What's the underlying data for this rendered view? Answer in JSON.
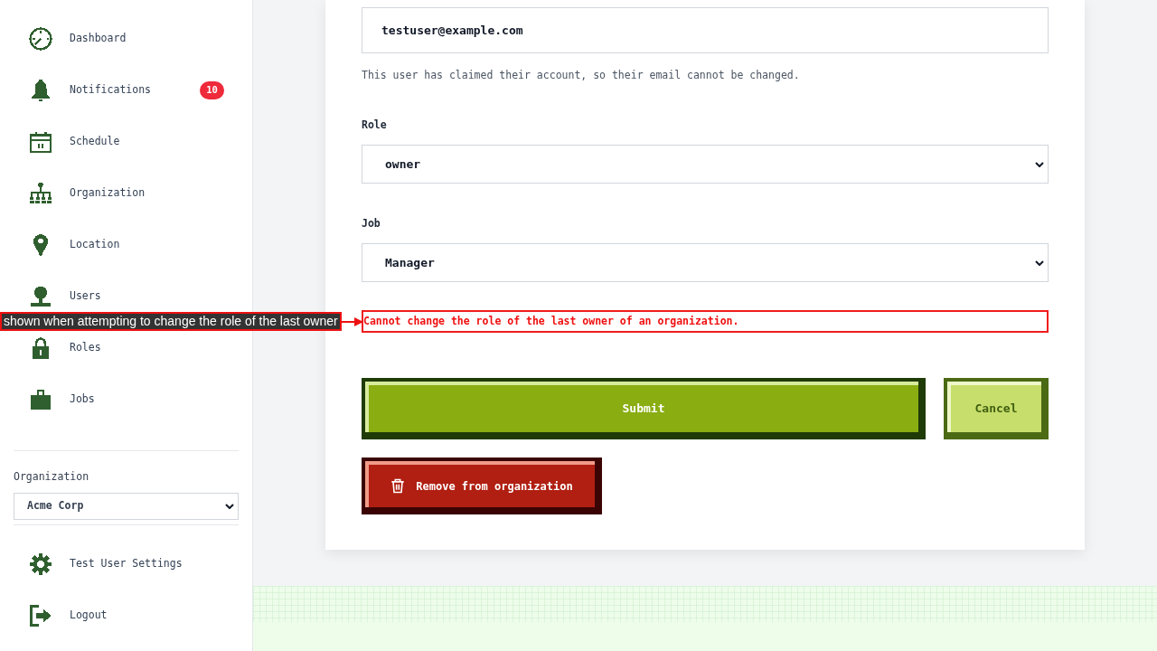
{
  "sidebar": {
    "nav_items": [
      {
        "label": "Dashboard"
      },
      {
        "label": "Notifications",
        "badge": "10"
      },
      {
        "label": "Schedule"
      },
      {
        "label": "Organization"
      },
      {
        "label": "Location"
      },
      {
        "label": "Users"
      },
      {
        "label": "Roles"
      },
      {
        "label": "Jobs"
      }
    ],
    "organization_picker": {
      "label": "Organization",
      "value": "Acme Corp"
    },
    "account_items": [
      {
        "label": "Test User Settings"
      },
      {
        "label": "Logout"
      }
    ]
  },
  "form": {
    "email_field": {
      "value": "testuser@example.com",
      "help_text": "This user has claimed their account, so their email cannot be changed."
    },
    "role_field": {
      "label": "Role",
      "value": "owner"
    },
    "job_field": {
      "label": "Job",
      "value": "Manager"
    },
    "error_message": "Cannot change the role of the last owner of an organization.",
    "actions": [
      {
        "kind": "primary",
        "label": "Submit"
      },
      {
        "kind": "secondary",
        "label": "Cancel"
      }
    ],
    "remove_button": {
      "label": "Remove from organization"
    }
  },
  "annotation": {
    "text": "shown when attempting to change the role of the last owner"
  }
}
